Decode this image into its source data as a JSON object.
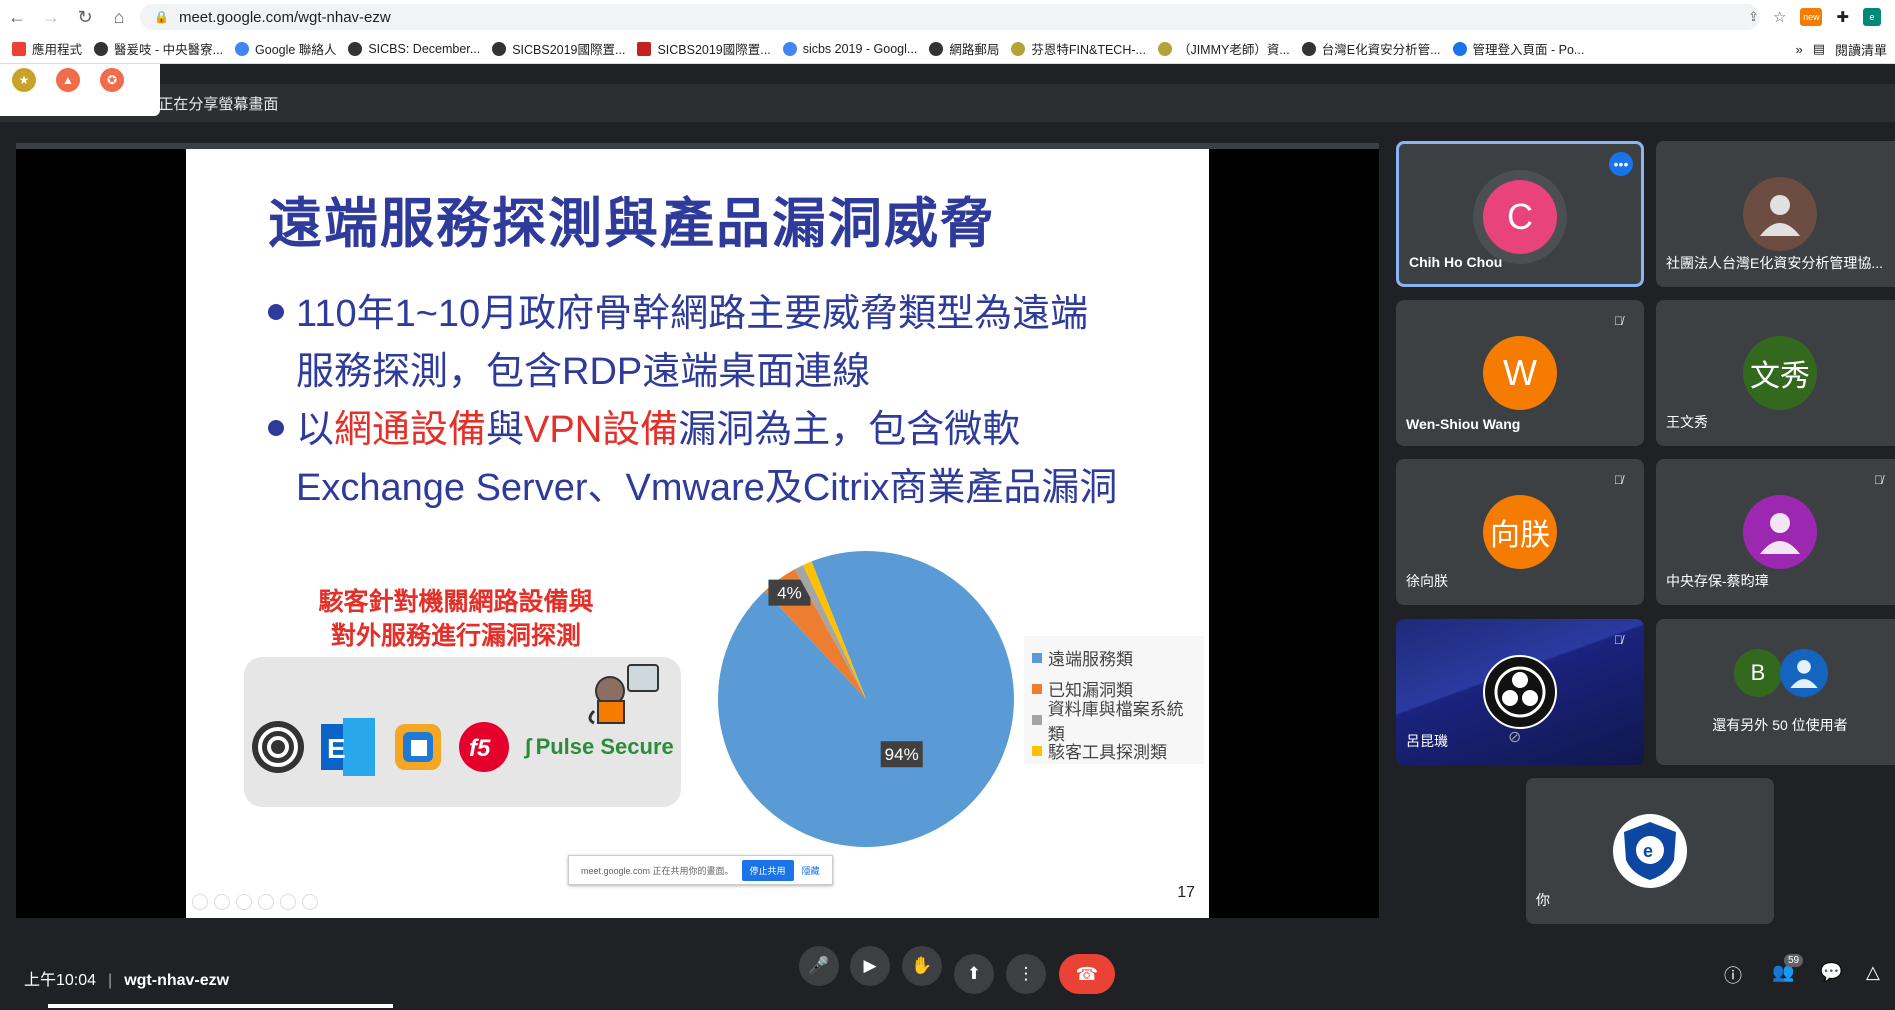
{
  "browser": {
    "url": "meet.google.com/wgt-nhav-ezw",
    "bookmarks": [
      {
        "label": "應用程式",
        "color": "#e94235"
      },
      {
        "label": "醫爰吱 - 中央醫寮...",
        "color": "#333333"
      },
      {
        "label": "Google 聯絡人",
        "color": "#4285f4"
      },
      {
        "label": "SICBS: December...",
        "color": "#333333"
      },
      {
        "label": "SICBS2019國際置...",
        "color": "#333333"
      },
      {
        "label": "SICBS2019國際置...",
        "color": "#c5221f"
      },
      {
        "label": "sicbs 2019 - Googl...",
        "color": "#4285f4"
      },
      {
        "label": "網路郵局",
        "color": "#333333"
      },
      {
        "label": "芬恩特FIN&TECH-...",
        "color": "#b5a33a"
      },
      {
        "label": "（JIMMY老師）資...",
        "color": "#b5a33a"
      },
      {
        "label": "台灣E化資安分析管...",
        "color": "#333333"
      },
      {
        "label": "管理登入頁面 - Po...",
        "color": "#1a73e8"
      }
    ],
    "reading_list": "閱讀清單",
    "ext_new_badge": "new"
  },
  "share_bar": {
    "text": "u正在分享螢幕畫面"
  },
  "slide": {
    "title": "遠端服務探測與產品漏洞威脅",
    "bullet1_line1": "110年1~10月政府骨幹網路主要威脅類型為遠端",
    "bullet1_line2": "服務探測，包含RDP遠端桌面連線",
    "bullet2_prefix": "以",
    "bullet2_red1": "網通設備",
    "bullet2_mid": "與",
    "bullet2_red2": "VPN設備",
    "bullet2_suffix": "漏洞為主，包含微軟",
    "bullet2_line2": "Exchange Server、Vmware及Citrix商業產品漏洞",
    "hacker_note_line1": "駭客針對機關網路設備與",
    "hacker_note_line2": "對外服務進行漏洞探測",
    "vendors": {
      "pulse": "Pulse Secure",
      "f5": "f5"
    },
    "page_number": "17",
    "share_notice": {
      "text": "meet.google.com 正在共用你的畫面。",
      "stop": "停止共用",
      "hide": "隱藏"
    }
  },
  "chart_data": {
    "type": "pie",
    "categories": [
      "遠端服務類",
      "已知漏洞類",
      "資料庫與檔案系統類",
      "駭客工具探測類"
    ],
    "values": [
      94,
      4,
      1,
      1
    ],
    "value_labels": [
      "94%",
      "4%"
    ],
    "colors": [
      "#5b9bd5",
      "#ed7d31",
      "#a5a5a5",
      "#ffc000"
    ],
    "legend_position": "right"
  },
  "participants": [
    {
      "name": "Chih Ho Chou",
      "initial": "C",
      "color": "#e8437b",
      "active": true
    },
    {
      "name": "社團法人台灣E化資安分析管理協...",
      "initial": "",
      "color": "#6d4c41"
    },
    {
      "name": "Wen-Shiou Wang",
      "initial": "W",
      "color": "#f57c00",
      "muted": true
    },
    {
      "name": "王文秀",
      "initial": "文秀",
      "color": "#33691e"
    },
    {
      "name": "徐向朕",
      "initial": "向朕",
      "color": "#f57c00",
      "muted": true
    },
    {
      "name": "中央存保-蔡昀璋",
      "initial": "",
      "color": "#9c27b0",
      "muted": true
    },
    {
      "name": "呂昆璣",
      "initial": "",
      "color": "#1a237e",
      "muted": true
    },
    {
      "name": "還有另外 50 位使用者",
      "initial": "B",
      "color": "#33691e"
    },
    {
      "name": "你",
      "initial": "",
      "color": "#ffffff"
    }
  ],
  "bottom_bar": {
    "time": "上午10:04",
    "meeting_code": "wgt-nhav-ezw",
    "people_count": "59"
  }
}
